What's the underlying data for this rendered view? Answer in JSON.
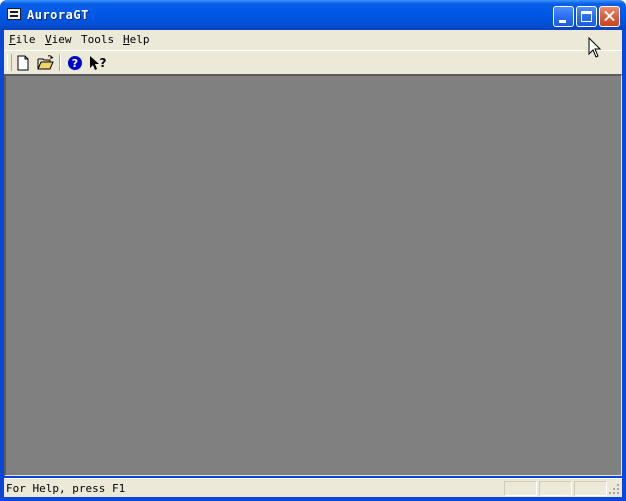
{
  "window": {
    "title": "AuroraGT",
    "controls": {
      "minimize": "minimize",
      "maximize": "maximize",
      "close": "close"
    }
  },
  "menubar": {
    "items": [
      {
        "label": "File",
        "mnemonic": "F",
        "rest": "ile"
      },
      {
        "label": "View",
        "mnemonic": "V",
        "rest": "iew"
      },
      {
        "label": "Tools",
        "mnemonic": "",
        "rest": "Tools"
      },
      {
        "label": "Help",
        "mnemonic": "H",
        "rest": "elp"
      }
    ]
  },
  "toolbar": {
    "buttons": [
      {
        "name": "new-document",
        "icon": "new-document-icon"
      },
      {
        "name": "open-folder",
        "icon": "open-folder-icon"
      },
      {
        "name": "help",
        "icon": "help-icon"
      },
      {
        "name": "whats-this",
        "icon": "whats-this-help-icon"
      }
    ]
  },
  "client_area": {
    "background": "#808080"
  },
  "statusbar": {
    "text": "For Help, press F1"
  },
  "colors": {
    "titlebar": "#0058e6",
    "close_button": "#d95b37",
    "face": "#ece9d8"
  }
}
